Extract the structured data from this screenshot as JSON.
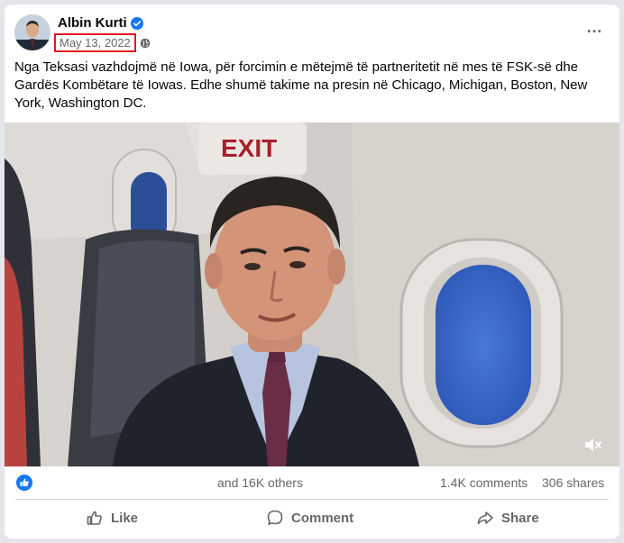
{
  "post": {
    "author": "Albin Kurti",
    "date": "May 13, 2022",
    "text": "Nga Teksasi vazhdojmë në Iowa, për forcimin e mëtejmë të partneritetit në mes të FSK-së dhe Gardës Kombëtare të Iowas. Edhe shumë takime na presin në Chicago, Michigan, Boston, New York, Washington DC.",
    "more_icon": "…"
  },
  "media": {
    "exit_sign": "EXIT"
  },
  "stats": {
    "reactions": "and 16K others",
    "comments": "1.4K comments",
    "shares": "306 shares"
  },
  "actions": {
    "like": "Like",
    "comment": "Comment",
    "share": "Share"
  },
  "colors": {
    "accent": "#1877f2",
    "date_highlight": "#e0191f",
    "secondary_text": "#65676b"
  }
}
